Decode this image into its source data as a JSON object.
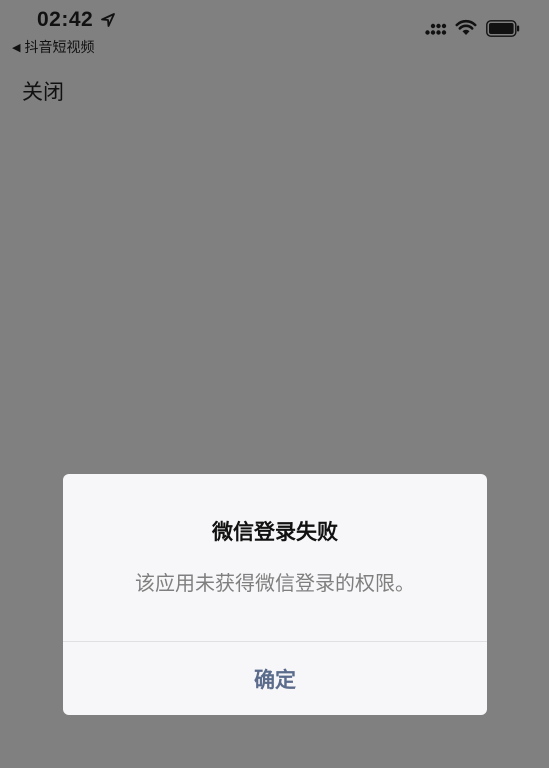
{
  "status_bar": {
    "time": "02:42",
    "back_app": "抖音短视频",
    "icons": [
      "location-arrow-icon",
      "signal-icon",
      "wifi-icon",
      "battery-icon"
    ]
  },
  "page": {
    "close_label": "关闭",
    "background_color": "#808080"
  },
  "dialog": {
    "title": "微信登录失败",
    "message": "该应用未获得微信登录的权限。",
    "confirm_label": "确定",
    "confirm_color": "#5b6b8c",
    "background_color": "#f7f6f8"
  }
}
